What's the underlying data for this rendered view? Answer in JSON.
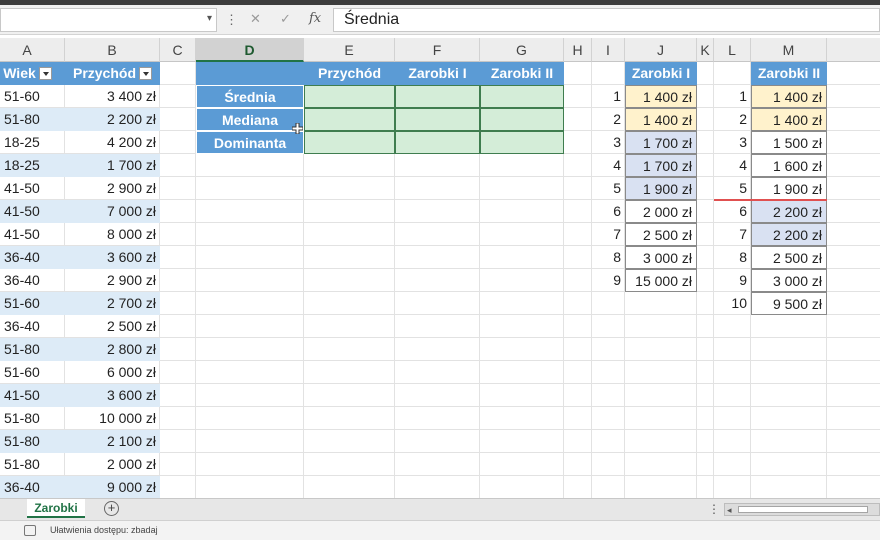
{
  "formula_bar": {
    "cancel_icon": "x-icon",
    "enter_icon": "check-icon",
    "fx_label": "fx",
    "value": "Średnia"
  },
  "columns": [
    "A",
    "B",
    "C",
    "D",
    "E",
    "F",
    "G",
    "H",
    "I",
    "J",
    "K",
    "L",
    "M"
  ],
  "selected_column": "D",
  "table1": {
    "headers": [
      "Wiek",
      "Przychód"
    ],
    "rows": [
      {
        "wiek": "51-60",
        "przychod": "3 400 zł"
      },
      {
        "wiek": "51-80",
        "przychod": "2 200 zł"
      },
      {
        "wiek": "18-25",
        "przychod": "4 200 zł"
      },
      {
        "wiek": "18-25",
        "przychod": "1 700 zł"
      },
      {
        "wiek": "41-50",
        "przychod": "2 900 zł"
      },
      {
        "wiek": "41-50",
        "przychod": "7 000 zł"
      },
      {
        "wiek": "41-50",
        "przychod": "8 000 zł"
      },
      {
        "wiek": "36-40",
        "przychod": "3 600 zł"
      },
      {
        "wiek": "36-40",
        "przychod": "2 900 zł"
      },
      {
        "wiek": "51-60",
        "przychod": "2 700 zł"
      },
      {
        "wiek": "36-40",
        "przychod": "2 500 zł"
      },
      {
        "wiek": "51-80",
        "przychod": "2 800 zł"
      },
      {
        "wiek": "51-60",
        "przychod": "6 000 zł"
      },
      {
        "wiek": "41-50",
        "przychod": "3 600 zł"
      },
      {
        "wiek": "51-80",
        "przychod": "10 000 zł"
      },
      {
        "wiek": "51-80",
        "przychod": "2 100 zł"
      },
      {
        "wiek": "51-80",
        "przychod": "2 000 zł"
      },
      {
        "wiek": "36-40",
        "przychod": "9 000 zł"
      }
    ]
  },
  "stats": {
    "headers": [
      "Przychód",
      "Zarobki I",
      "Zarobki II"
    ],
    "rows": [
      "Średnia",
      "Mediana",
      "Dominanta"
    ]
  },
  "zarobki1": {
    "header": "Zarobki I",
    "rows": [
      {
        "n": "1",
        "v": "1 400 zł",
        "hl": "yellow"
      },
      {
        "n": "2",
        "v": "1 400 zł",
        "hl": "yellow"
      },
      {
        "n": "3",
        "v": "1 700 zł",
        "hl": "blue"
      },
      {
        "n": "4",
        "v": "1 700 zł",
        "hl": "blue"
      },
      {
        "n": "5",
        "v": "1 900 zł",
        "hl": "blue"
      },
      {
        "n": "6",
        "v": "2 000 zł",
        "hl": "none"
      },
      {
        "n": "7",
        "v": "2 500 zł",
        "hl": "none"
      },
      {
        "n": "8",
        "v": "3 000 zł",
        "hl": "none"
      },
      {
        "n": "9",
        "v": "15 000 zł",
        "hl": "none"
      }
    ]
  },
  "zarobki2": {
    "header": "Zarobki II",
    "rows": [
      {
        "n": "1",
        "v": "1 400 zł",
        "hl": "yellow"
      },
      {
        "n": "2",
        "v": "1 400 zł",
        "hl": "yellow"
      },
      {
        "n": "3",
        "v": "1 500 zł",
        "hl": "none"
      },
      {
        "n": "4",
        "v": "1 600 zł",
        "hl": "none"
      },
      {
        "n": "5",
        "v": "1 900 zł",
        "hl": "none"
      },
      {
        "n": "6",
        "v": "2 200 zł",
        "hl": "blue"
      },
      {
        "n": "7",
        "v": "2 200 zł",
        "hl": "blue"
      },
      {
        "n": "8",
        "v": "2 500 zł",
        "hl": "none"
      },
      {
        "n": "9",
        "v": "3 000 zł",
        "hl": "none"
      },
      {
        "n": "10",
        "v": "9 500 zł",
        "hl": "none"
      }
    ]
  },
  "sheet_tabs": [
    "Zarobki"
  ],
  "add_sheet_label": "+",
  "status": {
    "accessibility": "Ułatwienia dostępu: zbadaj"
  },
  "colors": {
    "table_header": "#5b9bd5",
    "band": "#ddebf7",
    "green_fill": "#d4edd8",
    "yellow_fill": "#fff2cc",
    "blue_fill": "#d9e1f2",
    "median_line": "#e05050",
    "excel_green": "#217346"
  }
}
